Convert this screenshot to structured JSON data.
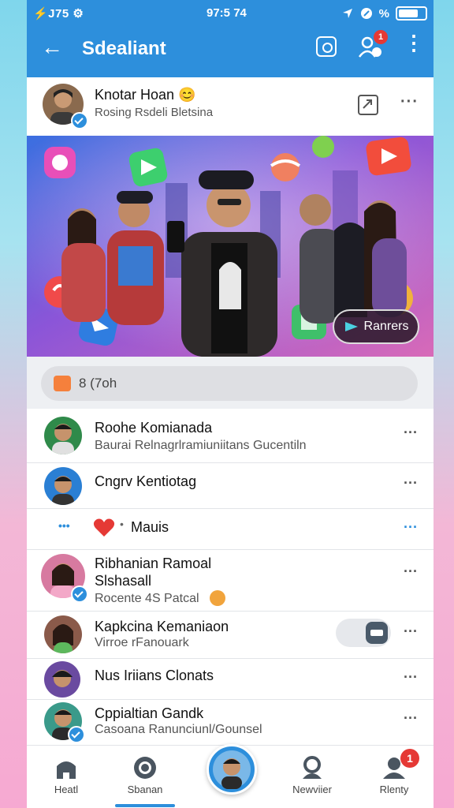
{
  "status": {
    "left": "⚡J75 ⚙",
    "time": "97:5 74",
    "right_icons": [
      "location-icon",
      "signal-icon",
      "percent-icon",
      "battery-icon"
    ]
  },
  "appbar": {
    "title": "Sdealiant",
    "people_badge": "1"
  },
  "profile": {
    "name": "Knotar Hoan 😊",
    "subtitle": "Rosing Rsdeli Bletsina"
  },
  "banner": {
    "button_label": "Ranrers"
  },
  "comment_pill": {
    "text": "8 (7oh"
  },
  "list": [
    {
      "name": "Roohe Komianada",
      "sub": "Baurai Relnagrlramiuniitans Gucentiln"
    },
    {
      "name": "Cngrv Kentiotag",
      "sub": ""
    },
    {
      "name": "Mauis",
      "sub": ""
    },
    {
      "name": "Ribhanian Ramoal",
      "name2": "Slshasall",
      "sub": "Rocente 4S Patcal"
    },
    {
      "name": "Kapkcina Kemaniaon",
      "sub": "Virroe rFanouark"
    },
    {
      "name": "Nus Iriians Clonats",
      "sub": ""
    },
    {
      "name": "Cppialtian Gandk",
      "sub": "Casoana Ranunciunl/Gounsel"
    }
  ],
  "bottom_nav": [
    {
      "label": "Heatl",
      "icon": "home-icon"
    },
    {
      "label": "Sbanan",
      "icon": "record-icon"
    },
    {
      "label": "",
      "icon": "profile-fab"
    },
    {
      "label": "Newviier",
      "icon": "person-icon"
    },
    {
      "label": "Rlenty",
      "icon": "user-badge-icon",
      "badge": "1"
    }
  ],
  "colors": {
    "primary": "#2d8fdc",
    "badge": "#e53935"
  }
}
